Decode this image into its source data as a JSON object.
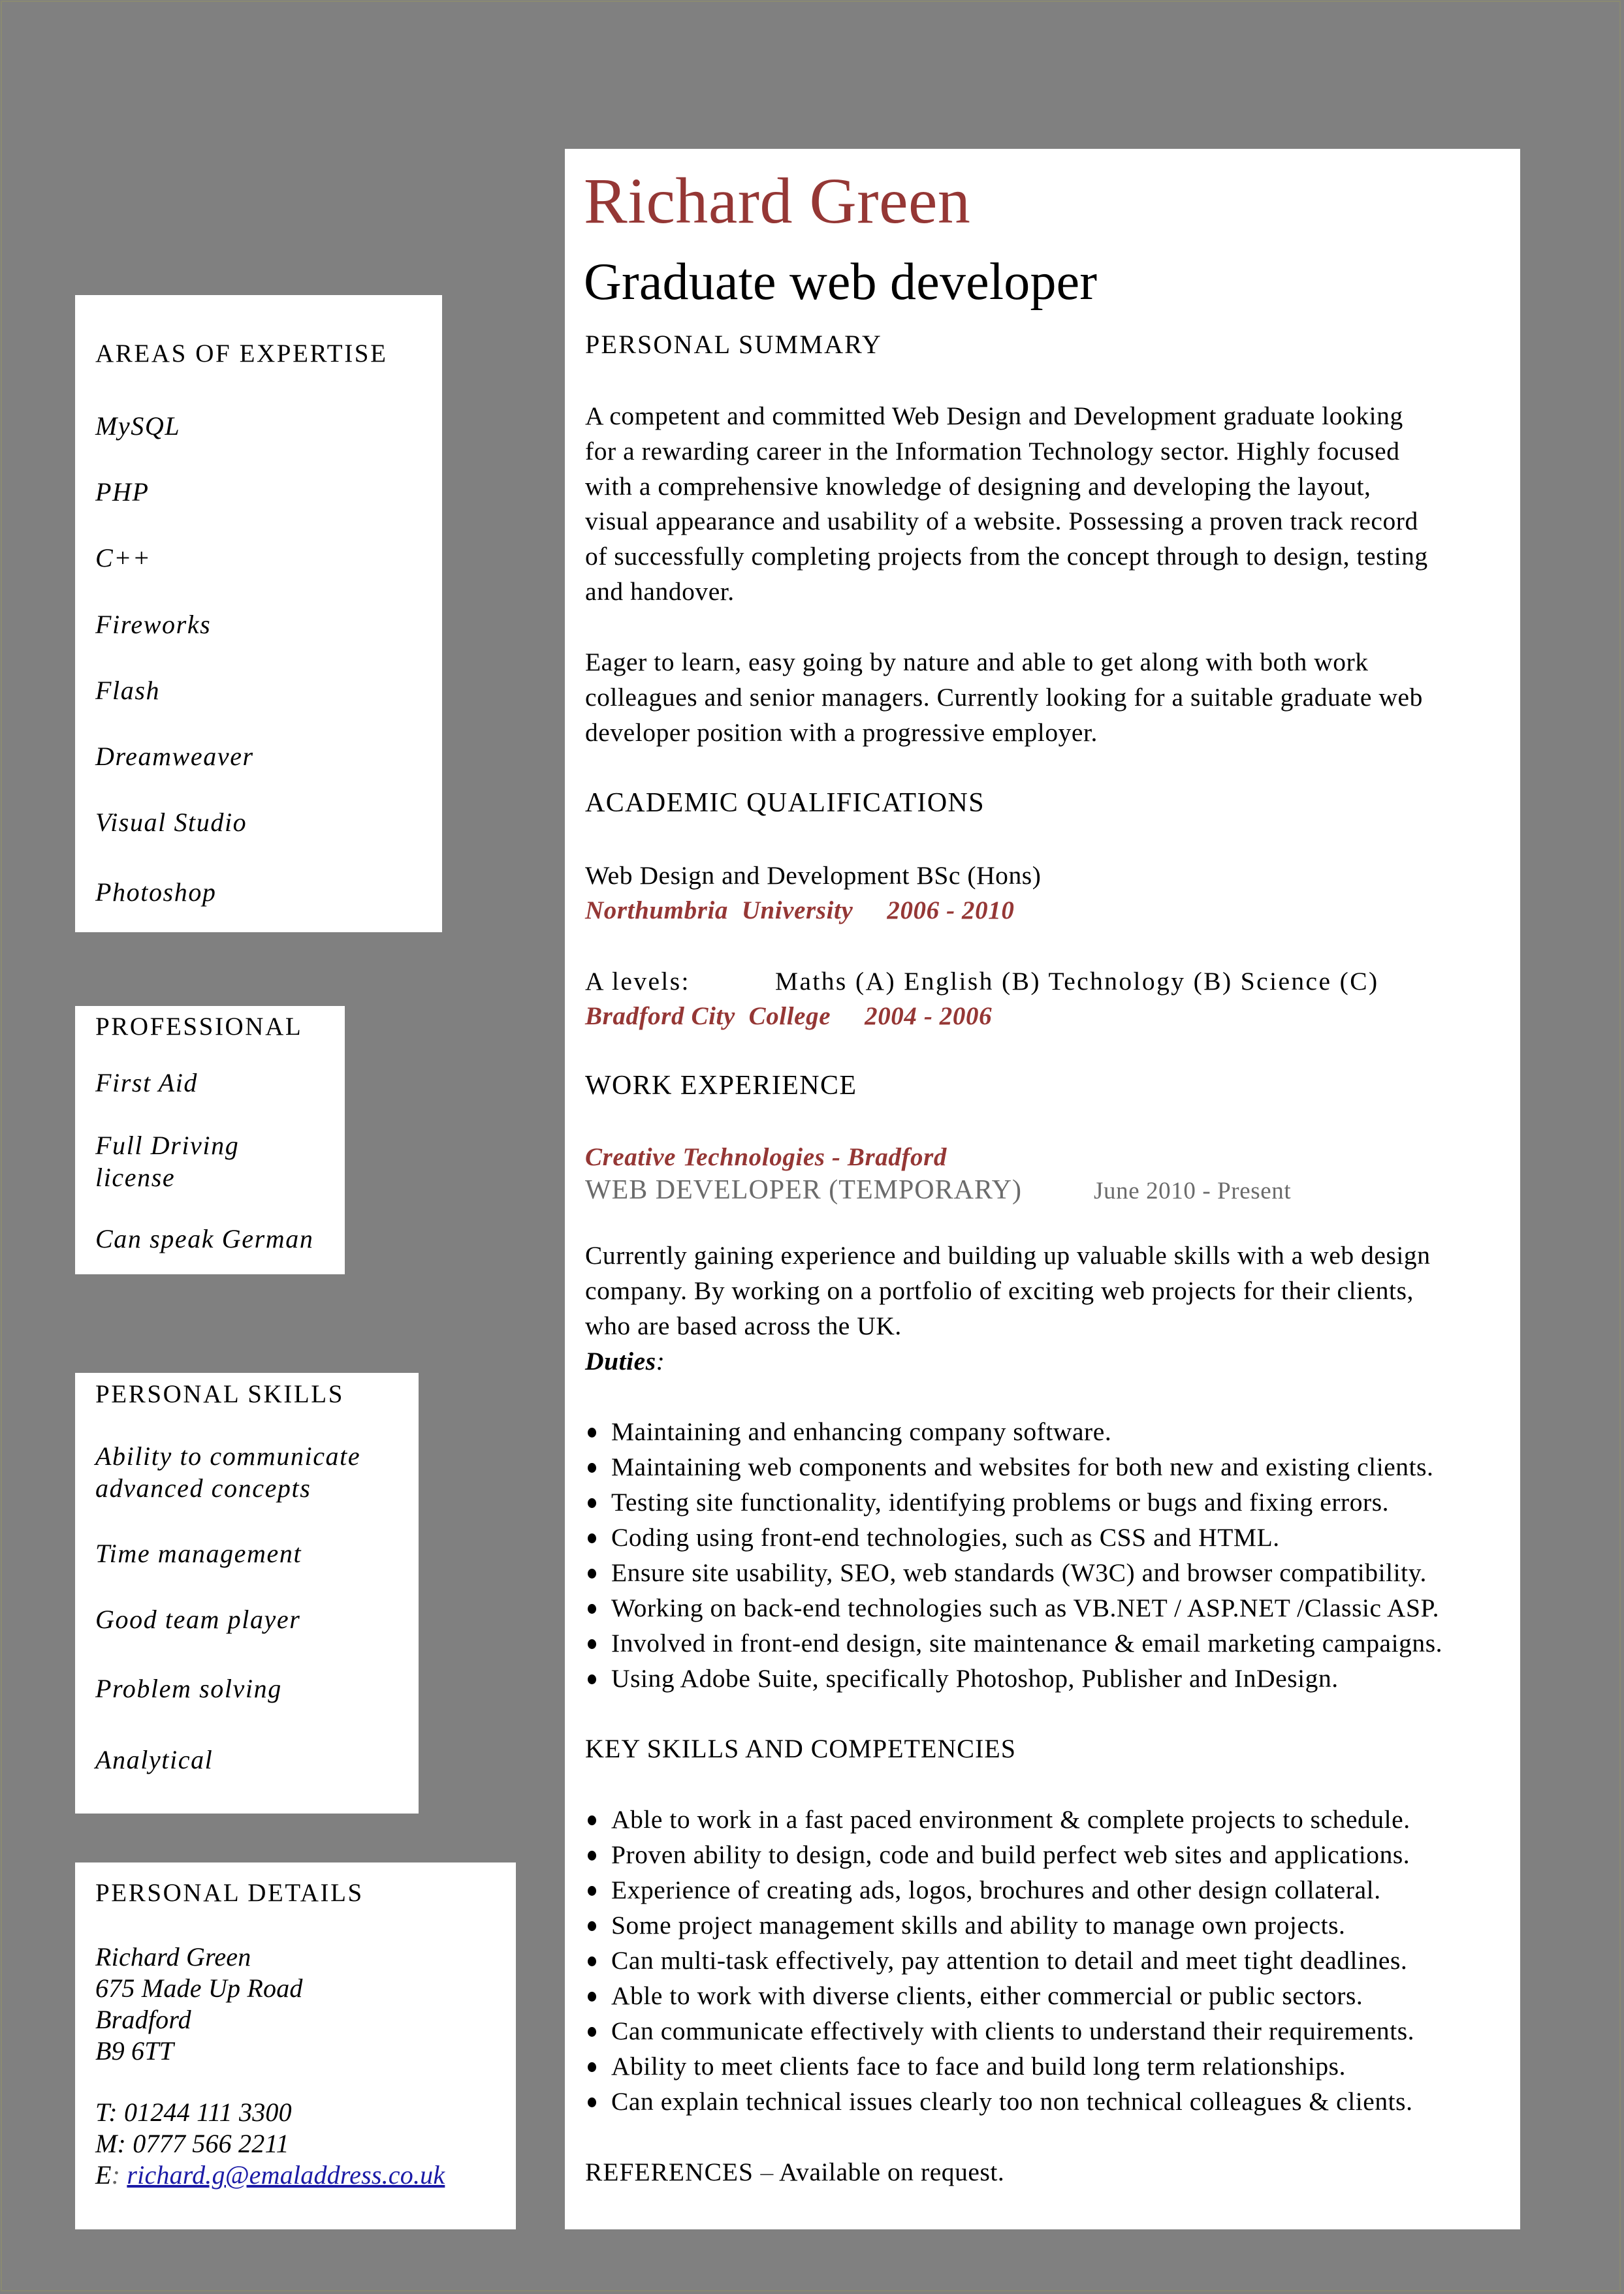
{
  "header": {
    "name": "Richard Green",
    "title": "Graduate web developer"
  },
  "sidebar": {
    "expertise": {
      "heading": "AREAS OF EXPERTISE",
      "items": [
        "MySQL",
        "PHP",
        "C++",
        "Fireworks",
        "Flash",
        "Dreamweaver",
        "Visual Studio",
        "Photoshop"
      ]
    },
    "professional": {
      "heading": "PROFESSIONAL",
      "items": [
        "First Aid",
        "Full Driving",
        "license",
        "Can speak German"
      ]
    },
    "personal_skills": {
      "heading": "PERSONAL SKILLS",
      "items": [
        "Ability to communicate",
        "advanced concepts",
        "Time management",
        "Good team player",
        "Problem solving",
        "Analytical"
      ]
    },
    "personal_details": {
      "heading": "PERSONAL DETAILS",
      "name": "Richard Green",
      "address": [
        "675 Made Up Road",
        "Bradford",
        "B9 6TT"
      ],
      "phone": "T: 01244 111 3300",
      "mobile": "M: 0777 566 2211",
      "email_label": "E",
      "email_sep": ": ",
      "email": "richard.g@emaladdress.co.uk"
    }
  },
  "summary": {
    "heading": "PERSONAL SUMMARY",
    "para1": [
      "A competent and committed Web Design and Development graduate looking",
      "for a rewarding career in the Information Technology sector. Highly focused",
      "with a comprehensive knowledge of designing and developing the layout,",
      "visual appearance and usability of a website. Possessing a proven track record",
      "of successfully completing projects from the concept through to design, testing",
      "and handover."
    ],
    "para2": [
      "Eager to learn, easy going by nature and able to get along with both work",
      "colleagues and senior managers. Currently looking for a suitable graduate web",
      "developer position with a progressive employer."
    ]
  },
  "academic": {
    "heading": "ACADEMIC QUALIFICATIONS",
    "degree": "Web Design and Development BSc (Hons)",
    "university": "Northumbria  University",
    "university_years": "2006 - 2010",
    "alevels_label": "A levels:",
    "alevels_subjects": "Maths (A) English (B) Technology (B) Science (C)",
    "college": "Bradford City  College",
    "college_years": "2004 - 2006"
  },
  "work": {
    "heading": "WORK EXPERIENCE",
    "company": "Creative Technologies - Bradford",
    "job_title": "WEB DEVELOPER (TEMPORARY)",
    "dates": "June 2010 - Present",
    "description": [
      "Currently gaining experience and building up valuable skills with a web design",
      "company. By working on a portfolio of exciting web projects for their clients,",
      "who are based across the UK."
    ],
    "duties_label": "Duties",
    "duties_colon": ":",
    "duties": [
      "Maintaining and enhancing company software.",
      "Maintaining web components and websites for both new and existing clients.",
      "Testing site functionality, identifying problems or bugs and fixing errors.",
      "Coding using front-end technologies, such as CSS and HTML.",
      "Ensure site usability, SEO, web standards (W3C) and browser compatibility.",
      "Working on back-end technologies such as VB.NET / ASP.NET /Classic ASP.",
      "Involved in front-end design, site maintenance & email marketing campaigns.",
      "Using Adobe Suite, specifically Photoshop, Publisher and InDesign."
    ]
  },
  "key_skills": {
    "heading": "KEY SKILLS AND COMPETENCIES",
    "items": [
      "Able to work in a fast paced environment & complete projects to schedule.",
      "Proven ability to design, code and build perfect web sites and applications.",
      "Experience of creating ads, logos, brochures and other design collateral.",
      "Some project management skills and ability to manage own projects.",
      "Can multi-task effectively, pay attention to detail and meet tight deadlines.",
      "Able to work with diverse clients, either commercial or public sectors.",
      "Can communicate effectively with clients to understand their requirements.",
      "Ability to meet clients face to face and build long term relationships.",
      "Can explain technical issues clearly too non technical colleagues & clients."
    ]
  },
  "references": {
    "label": "REFERENCES",
    "dash": " – ",
    "text": "Available on request."
  },
  "colors": {
    "background": "#808080",
    "panel": "#ffffff",
    "accent_red": "#953735",
    "muted_gray": "#6b6b6b",
    "link_blue": "#1a1aa6"
  }
}
